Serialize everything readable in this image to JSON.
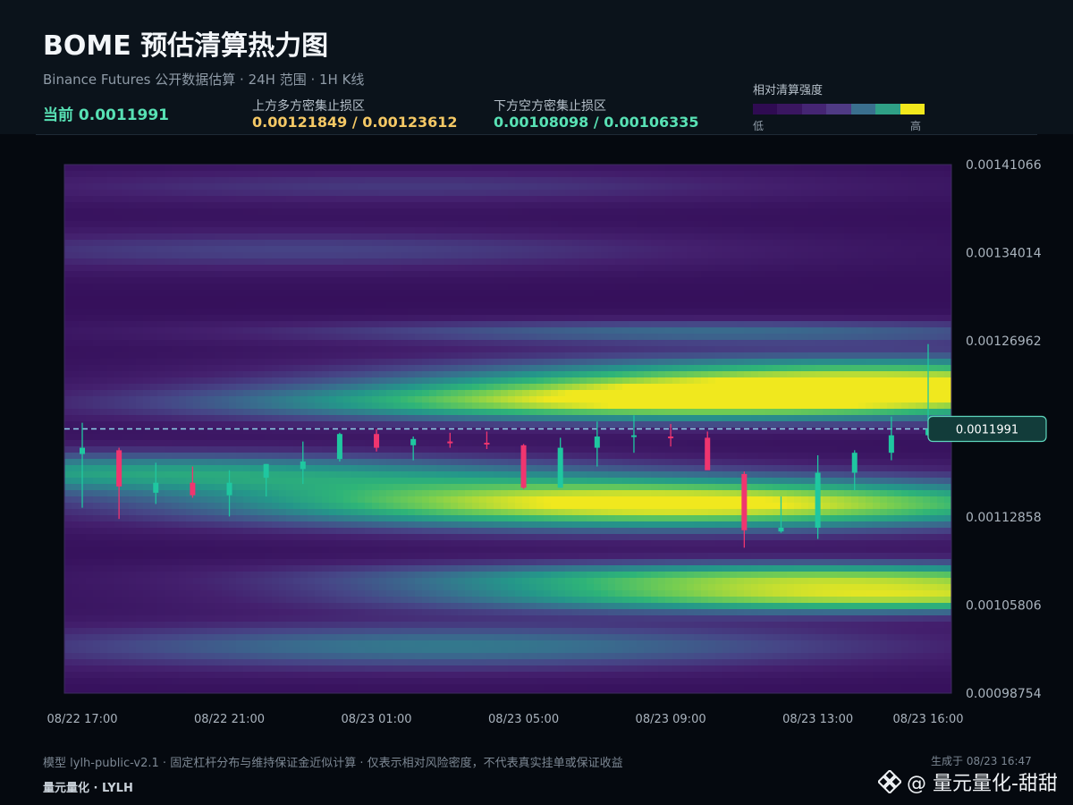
{
  "header": {
    "title": "BOME 预估清算热力图",
    "subtitle": "Binance Futures 公开数据估算 · 24H 范围 · 1H K线",
    "current_label": "当前 0.0011991",
    "upper_zone_label": "上方多方密集止损区",
    "upper_zone_value": "0.00121849 / 0.00123612",
    "lower_zone_label": "下方空方密集止损区",
    "lower_zone_value": "0.00108098 / 0.00106335",
    "legend_title": "相对清算强度",
    "legend_low": "低",
    "legend_high": "高"
  },
  "colors": {
    "upper_zone": "#f4c865",
    "lower_zone": "#58e1b4",
    "up_candle": "#1fc7a0",
    "down_candle": "#f0356f",
    "legend": [
      "#2f0b52",
      "#3a1660",
      "#452573",
      "#4f3a84",
      "#3a6f8e",
      "#2fa086",
      "#f2e81c"
    ]
  },
  "chart_data": {
    "type": "heatmap",
    "title": "BOME 预估清算热力图",
    "y_ticks": [
      "0.00141066",
      "0.00134014",
      "0.00126962",
      "0.00112858",
      "0.00105806",
      "0.00098754"
    ],
    "x_ticks": [
      "08/22 17:00",
      "08/22 21:00",
      "08/23 01:00",
      "08/23 05:00",
      "08/23 09:00",
      "08/23 13:00",
      "08/23 16:00"
    ],
    "ylim": [
      0.00098754,
      0.00141066
    ],
    "x_range": [
      "08/22 17:00",
      "08/23 16:00"
    ],
    "current_price": 0.0011991,
    "current_price_label": "0.0011991",
    "bands": [
      {
        "center": 0.00123612,
        "width": 1.55e-05,
        "peak_intensity": 0.92,
        "peak_time": "08/23 14:30"
      },
      {
        "center": 0.00121849,
        "width": 1.1e-05,
        "peak_intensity": 0.62,
        "peak_time": "08/23 08:00"
      },
      {
        "center": 0.001277,
        "width": 7e-06,
        "peak_intensity": 0.38,
        "peak_time": "08/23 10:00"
      },
      {
        "center": 0.001139,
        "width": 1.5e-05,
        "peak_intensity": 1.0,
        "peak_time": "08/23 09:00"
      },
      {
        "center": 0.00108098,
        "width": 9e-06,
        "peak_intensity": 0.72,
        "peak_time": "08/23 13:00"
      },
      {
        "center": 0.00106335,
        "width": 9e-06,
        "peak_intensity": 0.78,
        "peak_time": "08/23 15:00"
      },
      {
        "center": 0.001025,
        "width": 1.4e-05,
        "peak_intensity": 0.45,
        "peak_time": "08/23 03:00"
      },
      {
        "center": 0.001165,
        "width": 1.2e-05,
        "peak_intensity": 0.55,
        "peak_time": "08/22 18:00"
      },
      {
        "center": 0.001342,
        "width": 1.2e-05,
        "peak_intensity": 0.26,
        "peak_time": "08/22 23:00"
      },
      {
        "center": 0.001393,
        "width": 1e-05,
        "peak_intensity": 0.22,
        "peak_time": "08/23 02:00"
      }
    ],
    "candles": [
      {
        "time": "08/22 17:00",
        "open": 0.001179,
        "high": 0.001204,
        "low": 0.001136,
        "close": 0.001184
      },
      {
        "time": "08/22 18:00",
        "open": 0.001182,
        "high": 0.001184,
        "low": 0.001127,
        "close": 0.001153
      },
      {
        "time": "08/22 19:00",
        "open": 0.001148,
        "high": 0.001172,
        "low": 0.001139,
        "close": 0.001156
      },
      {
        "time": "08/22 20:00",
        "open": 0.001156,
        "high": 0.001169,
        "low": 0.001144,
        "close": 0.001146
      },
      {
        "time": "08/22 21:00",
        "open": 0.001146,
        "high": 0.001166,
        "low": 0.001129,
        "close": 0.001156
      },
      {
        "time": "08/22 22:00",
        "open": 0.00116,
        "high": 0.001171,
        "low": 0.001145,
        "close": 0.001171
      },
      {
        "time": "08/22 23:00",
        "open": 0.001167,
        "high": 0.001189,
        "low": 0.001155,
        "close": 0.001173
      },
      {
        "time": "08/23 00:00",
        "open": 0.001175,
        "high": 0.001196,
        "low": 0.001173,
        "close": 0.001195
      },
      {
        "time": "08/23 01:00",
        "open": 0.001195,
        "high": 0.001199,
        "low": 0.001181,
        "close": 0.001184
      },
      {
        "time": "08/23 02:00",
        "open": 0.001186,
        "high": 0.001193,
        "low": 0.001174,
        "close": 0.001191
      },
      {
        "time": "08/23 03:00",
        "open": 0.001189,
        "high": 0.001196,
        "low": 0.001184,
        "close": 0.001188
      },
      {
        "time": "08/23 04:00",
        "open": 0.001188,
        "high": 0.001197,
        "low": 0.001183,
        "close": 0.001187
      },
      {
        "time": "08/23 05:00",
        "open": 0.001186,
        "high": 0.001187,
        "low": 0.001151,
        "close": 0.001152
      },
      {
        "time": "08/23 06:00",
        "open": 0.001152,
        "high": 0.001192,
        "low": 0.001152,
        "close": 0.001184
      },
      {
        "time": "08/23 07:00",
        "open": 0.001184,
        "high": 0.001205,
        "low": 0.001169,
        "close": 0.001193
      },
      {
        "time": "08/23 08:00",
        "open": 0.001193,
        "high": 0.00121,
        "low": 0.00118,
        "close": 0.001194
      },
      {
        "time": "08/23 09:00",
        "open": 0.001193,
        "high": 0.001203,
        "low": 0.001185,
        "close": 0.001192
      },
      {
        "time": "08/23 10:00",
        "open": 0.001192,
        "high": 0.001197,
        "low": 0.001167,
        "close": 0.001166
      },
      {
        "time": "08/23 11:00",
        "open": 0.001163,
        "high": 0.001165,
        "low": 0.001104,
        "close": 0.001118
      },
      {
        "time": "08/23 12:00",
        "open": 0.001117,
        "high": 0.001145,
        "low": 0.001116,
        "close": 0.00112
      },
      {
        "time": "08/23 13:00",
        "open": 0.00112,
        "high": 0.001178,
        "low": 0.001111,
        "close": 0.001164
      },
      {
        "time": "08/23 14:00",
        "open": 0.001164,
        "high": 0.001182,
        "low": 0.00115,
        "close": 0.00118
      },
      {
        "time": "08/23 15:00",
        "open": 0.00118,
        "high": 0.001209,
        "low": 0.001174,
        "close": 0.001194
      },
      {
        "time": "08/23 16:00",
        "open": 0.001194,
        "high": 0.001267,
        "low": 0.001193,
        "close": 0.0011991
      }
    ]
  },
  "footer": {
    "note": "模型 lylh-public-v2.1 · 固定杠杆分布与维持保证金近似计算 · 仅表示相对风险密度，不代表真实挂单或保证收益",
    "generated": "生成于 08/23 16:47",
    "brand": "量元量化 · LYLH",
    "watermark": "@ 量元量化-甜甜"
  }
}
